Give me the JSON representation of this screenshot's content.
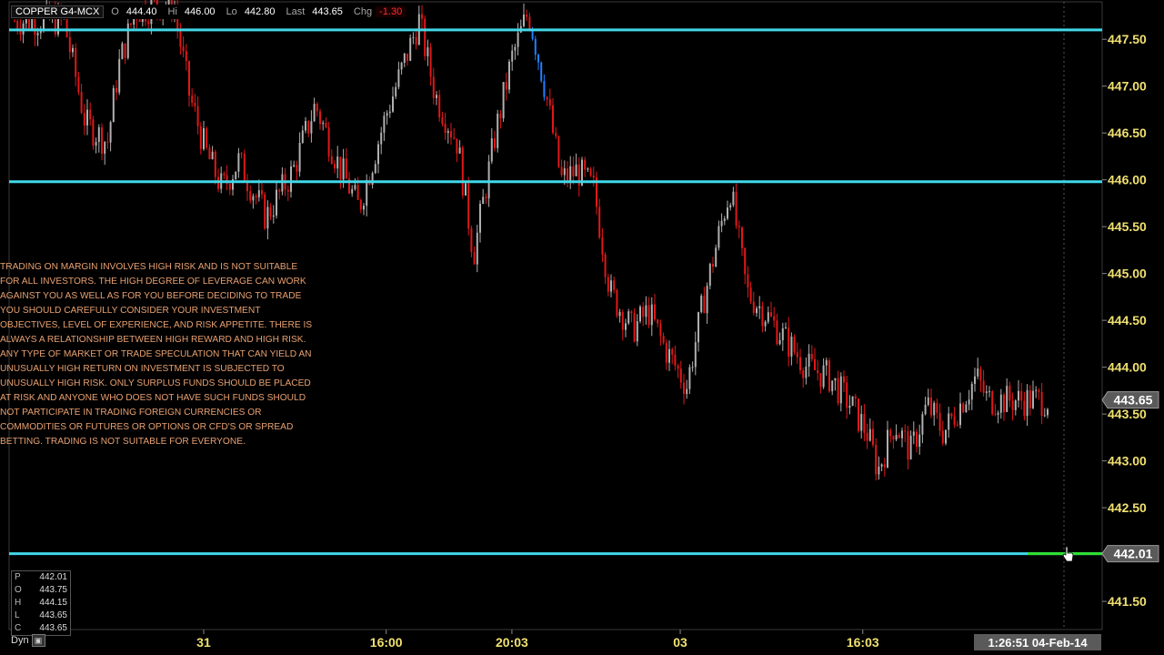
{
  "header": {
    "symbol": "COPPER G4-MCX",
    "o_label": "O",
    "o_value": "444.40",
    "hi_label": "Hi",
    "hi_value": "446.00",
    "lo_label": "Lo",
    "lo_value": "442.80",
    "last_label": "Last",
    "last_value": "443.65",
    "chg_label": "Chg",
    "chg_value": "-1.30"
  },
  "disclaimer": "TRADING ON MARGIN INVOLVES HIGH RISK AND IS NOT SUITABLE FOR ALL INVESTORS. THE HIGH DEGREE OF LEVERAGE CAN WORK AGAINST YOU AS WELL AS FOR YOU BEFORE DECIDING TO TRADE YOU SHOULD CAREFULLY CONSIDER YOUR INVESTMENT OBJECTIVES, LEVEL OF EXPERIENCE, AND RISK APPETITE. THERE IS ALWAYS A RELATIONSHIP BETWEEN HIGH REWARD AND HIGH RISK. ANY TYPE OF MARKET OR TRADE SPECULATION THAT CAN YIELD AN UNUSUALLY HIGH RETURN ON INVESTMENT IS SUBJECTED TO UNUSUALLY HIGH RISK. ONLY SURPLUS FUNDS SHOULD BE PLACED AT RISK AND ANYONE WHO DOES NOT HAVE SUCH FUNDS SHOULD NOT PARTICIPATE IN TRADING FOREIGN CURRENCIES OR COMMODITIES OR FUTURES OR OPTIONS OR CFD'S OR SPREAD BETTING. TRADING IS NOT SUITABLE FOR EVERYONE.",
  "ohlc_box": [
    {
      "k": "P",
      "v": "442.01"
    },
    {
      "k": "O",
      "v": "443.75"
    },
    {
      "k": "H",
      "v": "444.15"
    },
    {
      "k": "L",
      "v": "443.65"
    },
    {
      "k": "C",
      "v": "443.65"
    }
  ],
  "dyn_label": "Dyn",
  "time_badge": "1:26:51 04-Feb-14",
  "chart_data": {
    "type": "candlestick",
    "ylim": [
      441.2,
      447.9
    ],
    "y_ticks": [
      "447.50",
      "447.00",
      "446.50",
      "446.00",
      "445.50",
      "445.00",
      "444.50",
      "444.00",
      "443.50",
      "443.00",
      "442.50",
      "441.50"
    ],
    "y_tick_values": [
      447.5,
      447.0,
      446.5,
      446.0,
      445.5,
      445.0,
      444.5,
      444.0,
      443.5,
      443.0,
      442.5,
      441.5
    ],
    "x_ticks": [
      "31",
      "16:00",
      "20:03",
      "03",
      "16:03"
    ],
    "x_tick_positions": [
      0.178,
      0.345,
      0.46,
      0.614,
      0.781
    ],
    "horizontal_lines": [
      {
        "value": 447.6,
        "color": "#40d8e8"
      },
      {
        "value": 445.98,
        "color": "#40d8e8"
      },
      {
        "value": 442.01,
        "color": "#40d8e8"
      }
    ],
    "last_price_label": "443.65",
    "last_price_value": 443.65,
    "cursor_price_label": "442.01",
    "cursor_price_value": 442.01,
    "colors": {
      "up": "#b0b0b0",
      "down": "#e01818",
      "highlight": "#2080ff",
      "level_line": "#40d8e8",
      "bg": "#000000"
    },
    "series": [
      {
        "x": 0.05,
        "close": 447.7
      },
      {
        "x": 0.07,
        "close": 446.6
      },
      {
        "x": 0.09,
        "close": 446.4
      },
      {
        "x": 0.1,
        "close": 447.2
      },
      {
        "x": 0.115,
        "close": 447.8
      },
      {
        "x": 0.15,
        "close": 447.9
      },
      {
        "x": 0.165,
        "close": 446.9
      },
      {
        "x": 0.18,
        "close": 446.3
      },
      {
        "x": 0.195,
        "close": 445.9
      },
      {
        "x": 0.21,
        "close": 446.2
      },
      {
        "x": 0.235,
        "close": 445.6
      },
      {
        "x": 0.26,
        "close": 446.1
      },
      {
        "x": 0.28,
        "close": 446.8
      },
      {
        "x": 0.3,
        "close": 446.2
      },
      {
        "x": 0.32,
        "close": 445.7
      },
      {
        "x": 0.345,
        "close": 446.7
      },
      {
        "x": 0.36,
        "close": 447.2
      },
      {
        "x": 0.375,
        "close": 447.7
      },
      {
        "x": 0.39,
        "close": 446.9
      },
      {
        "x": 0.41,
        "close": 446.4
      },
      {
        "x": 0.425,
        "close": 445.2
      },
      {
        "x": 0.445,
        "close": 446.5
      },
      {
        "x": 0.46,
        "close": 447.3
      },
      {
        "x": 0.475,
        "close": 447.8
      },
      {
        "x": 0.49,
        "close": 447.0
      },
      {
        "x": 0.505,
        "close": 446.0
      },
      {
        "x": 0.52,
        "close": 446.1
      },
      {
        "x": 0.535,
        "close": 445.9
      },
      {
        "x": 0.55,
        "close": 444.8
      },
      {
        "x": 0.57,
        "close": 444.4
      },
      {
        "x": 0.585,
        "close": 444.6
      },
      {
        "x": 0.6,
        "close": 444.2
      },
      {
        "x": 0.62,
        "close": 443.8
      },
      {
        "x": 0.635,
        "close": 444.7
      },
      {
        "x": 0.655,
        "close": 445.7
      },
      {
        "x": 0.66,
        "close": 445.9
      },
      {
        "x": 0.675,
        "close": 444.8
      },
      {
        "x": 0.69,
        "close": 444.6
      },
      {
        "x": 0.71,
        "close": 444.3
      },
      {
        "x": 0.73,
        "close": 444.0
      },
      {
        "x": 0.75,
        "close": 443.9
      },
      {
        "x": 0.77,
        "close": 443.6
      },
      {
        "x": 0.785,
        "close": 443.3
      },
      {
        "x": 0.795,
        "close": 442.9
      },
      {
        "x": 0.81,
        "close": 443.4
      },
      {
        "x": 0.825,
        "close": 443.1
      },
      {
        "x": 0.84,
        "close": 443.6
      },
      {
        "x": 0.855,
        "close": 443.3
      },
      {
        "x": 0.87,
        "close": 443.6
      },
      {
        "x": 0.885,
        "close": 443.9
      },
      {
        "x": 0.895,
        "close": 443.65
      }
    ]
  }
}
